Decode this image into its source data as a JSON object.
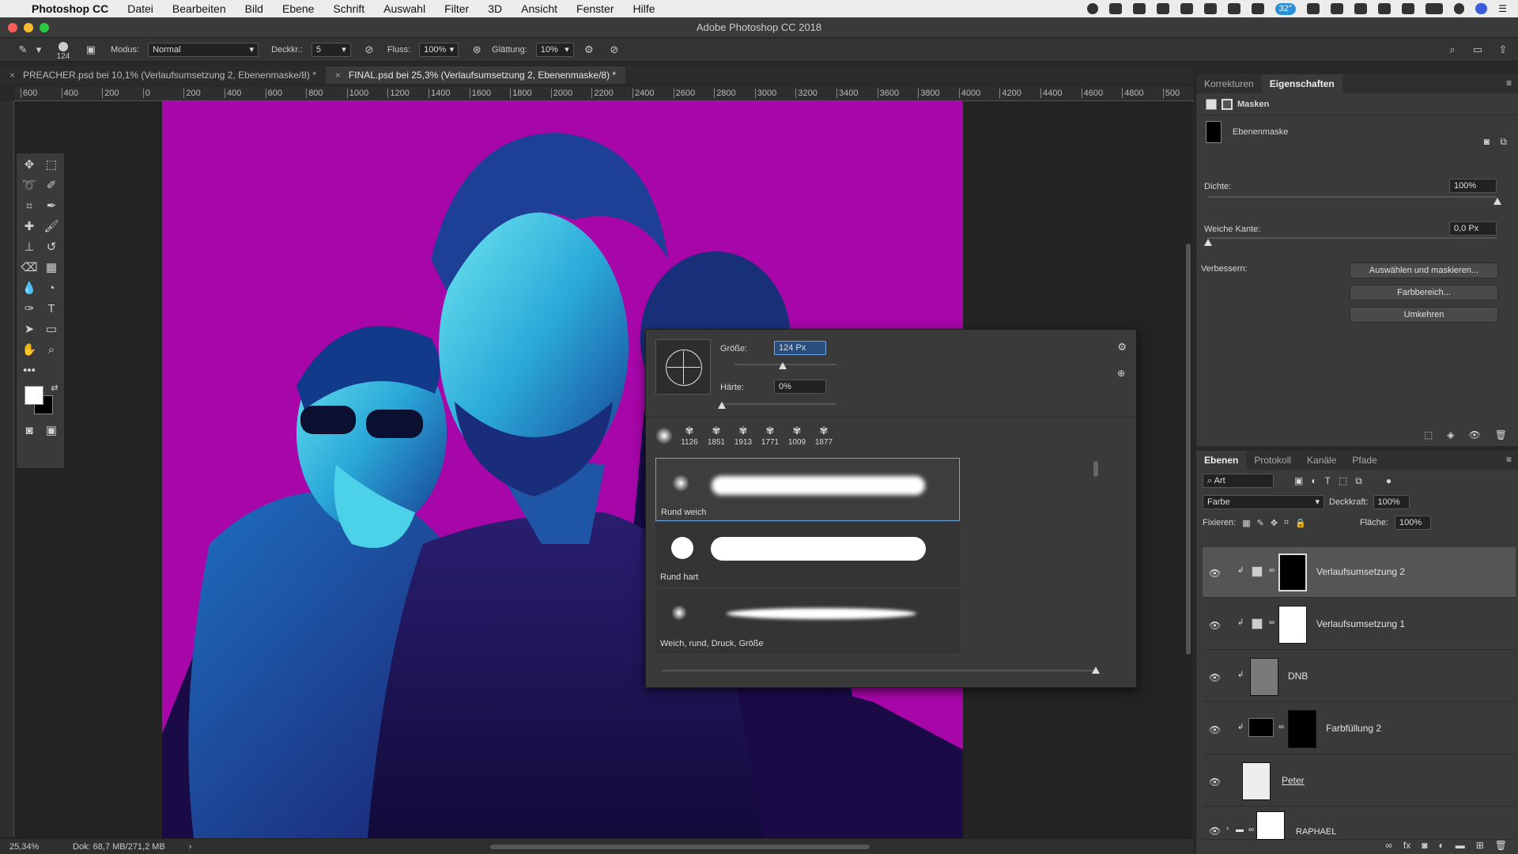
{
  "menubar": {
    "apple": "",
    "app": "Photoshop CC",
    "items": [
      "Datei",
      "Bearbeiten",
      "Bild",
      "Ebene",
      "Schrift",
      "Auswahl",
      "Filter",
      "3D",
      "Ansicht",
      "Fenster",
      "Hilfe"
    ],
    "badge": "32°"
  },
  "window": {
    "title": "Adobe Photoshop CC 2018"
  },
  "options": {
    "brush_size": "124",
    "mode_label": "Modus:",
    "mode_value": "Normal",
    "opacity_label": "Deckkr.:",
    "opacity_value": "5",
    "flow_label": "Fluss:",
    "flow_value": "100%",
    "smoothing_label": "Glättung:",
    "smoothing_value": "10%"
  },
  "tabs": [
    {
      "label": "PREACHER.psd bei 10,1% (Verlaufsumsetzung 2, Ebenenmaske/8) *"
    },
    {
      "label": "FINAL.psd bei 25,3% (Verlaufsumsetzung 2, Ebenenmaske/8) *"
    }
  ],
  "ruler": {
    "h_ticks": [
      "600",
      "400",
      "200",
      "0",
      "200",
      "400",
      "600",
      "800",
      "1000",
      "1200",
      "1400",
      "1600",
      "1800",
      "2000",
      "2200",
      "2400",
      "2600",
      "2800",
      "3000",
      "3200",
      "3400",
      "3600",
      "3800",
      "4000",
      "4200",
      "4400",
      "4600",
      "4800",
      "500"
    ]
  },
  "brush_popup": {
    "size_label": "Größe:",
    "size_value": "124 Px",
    "hardness_label": "Härte:",
    "hardness_value": "0%",
    "size_level": 0.48,
    "hardness_level": 0.0,
    "recent": [
      "1126",
      "1851",
      "1913",
      "1771",
      "1009",
      "1877"
    ],
    "presets": [
      {
        "name": "Rund weich"
      },
      {
        "name": "Rund hart"
      },
      {
        "name": "Weich, rund, Druck, Größe"
      }
    ]
  },
  "properties": {
    "tabs": [
      "Korrekturen",
      "Eigenschaften"
    ],
    "section": "Masken",
    "mask_type": "Ebenenmaske",
    "density_label": "Dichte:",
    "density_value": "100%",
    "feather_label": "Weiche Kante:",
    "feather_value": "0,0 Px",
    "refine_label": "Verbessern:",
    "buttons": [
      "Auswählen und maskieren...",
      "Farbbereich...",
      "Umkehren"
    ]
  },
  "layers_panel": {
    "tabs": [
      "Ebenen",
      "Protokoll",
      "Kanäle",
      "Pfade"
    ],
    "filter_kind": "Art",
    "blend_mode": "Farbe",
    "opacity_label": "Deckkraft:",
    "opacity_value": "100%",
    "lock_label": "Fixieren:",
    "fill_label": "Fläche:",
    "fill_value": "100%",
    "layers": [
      {
        "name": "Verlaufsumsetzung 2"
      },
      {
        "name": "Verlaufsumsetzung 1"
      },
      {
        "name": "DNB"
      },
      {
        "name": "Farbfüllung 2"
      },
      {
        "name": "Peter"
      },
      {
        "name": "RAPHAEL"
      }
    ]
  },
  "status": {
    "zoom": "25,34%",
    "doc": "Dok: 68,7 MB/271,2 MB"
  },
  "colors": {
    "canvas": "#a706a9",
    "foreground": "#ffffff",
    "background": "#000000",
    "selection": "#6ea6e4"
  }
}
